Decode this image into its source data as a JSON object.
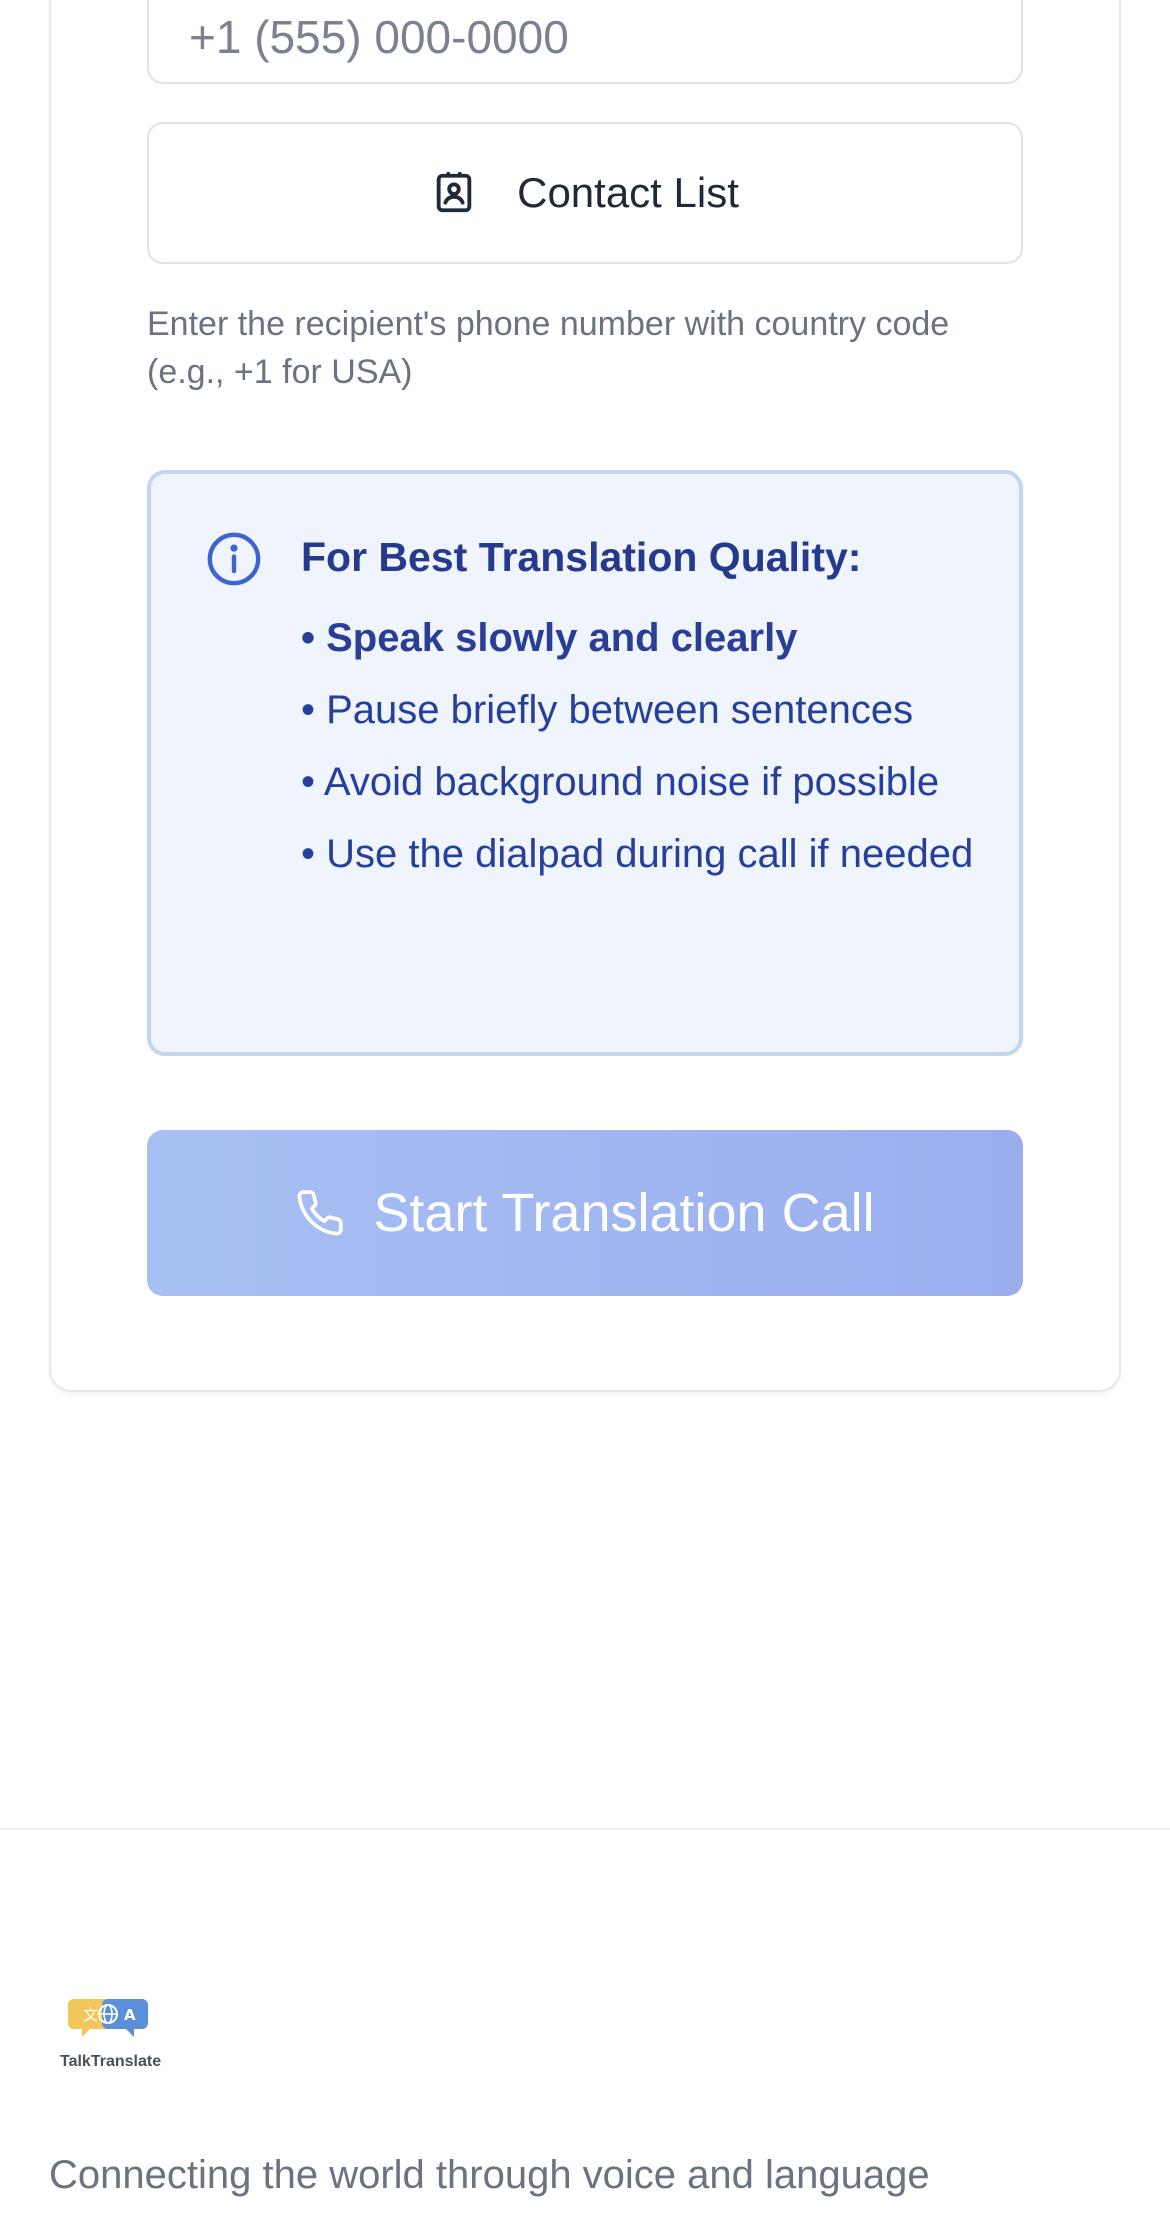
{
  "form": {
    "phone_placeholder": "+1 (555) 000-0000",
    "contact_button_label": "Contact List",
    "helper_text": "Enter the recipient's phone number with country code (e.g., +1 for USA)"
  },
  "tips": {
    "title": "For Best Translation Quality:",
    "items": [
      "• Speak slowly and clearly",
      "• Pause briefly between sentences",
      "• Avoid background noise if possible",
      "• Use the dialpad during call if needed"
    ]
  },
  "start_button_label": "Start Translation Call",
  "footer": {
    "logo_text": "TalkTranslate",
    "tagline": "Connecting the world through voice and language"
  },
  "colors": {
    "info_border": "#c3d6f1",
    "info_background": "#eff4fd",
    "info_text": "#273f9c",
    "start_button": "#a3b7f1"
  },
  "icons": {
    "contact": "contact-list-icon",
    "info": "info-icon",
    "phone": "phone-icon"
  }
}
